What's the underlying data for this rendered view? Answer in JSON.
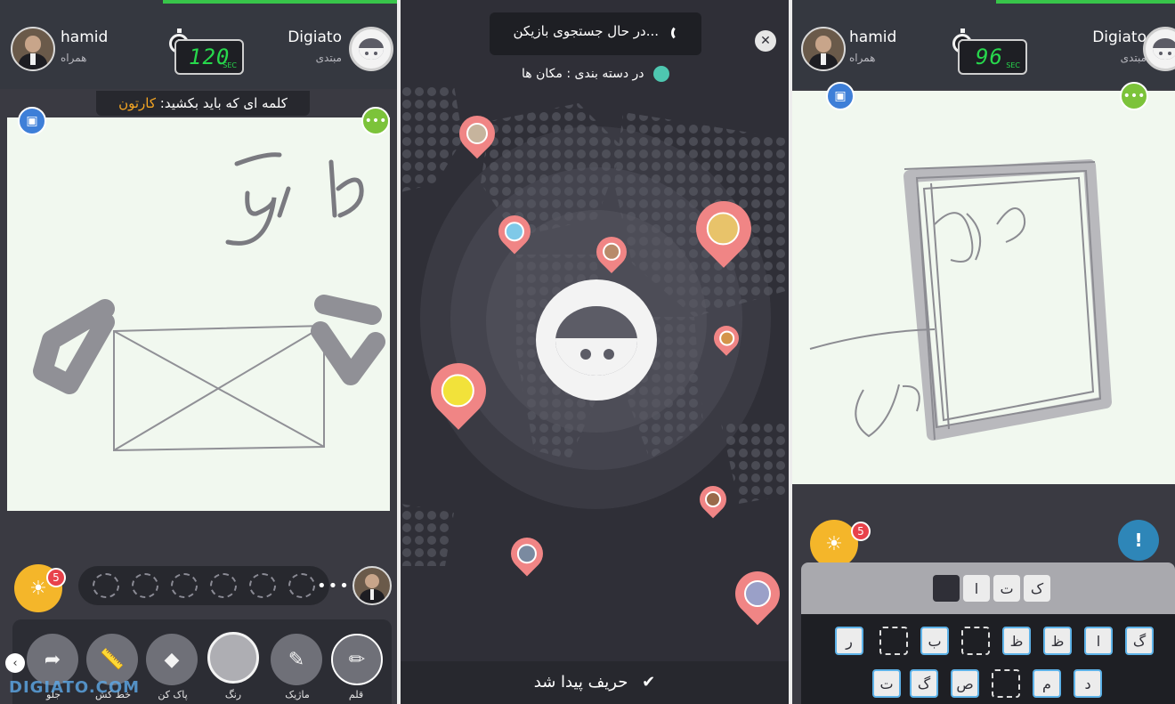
{
  "panel1": {
    "player_left": {
      "name": "hamid",
      "level": "همراه"
    },
    "player_right": {
      "name": "Digiato",
      "level": "مبتدی"
    },
    "timer": {
      "value": "120",
      "unit": "SEC"
    },
    "word_prompt": {
      "label": "کلمه ای که باید بکشید:",
      "word": "کارتون"
    },
    "hint_count": "5",
    "tools": [
      {
        "label": "جلو",
        "icon": "redo-arrow-icon"
      },
      {
        "label": "خط کش",
        "icon": "ruler-icon"
      },
      {
        "label": "پاک کن",
        "icon": "eraser-icon"
      },
      {
        "label": "رنگ",
        "icon": "color-swatch-icon"
      },
      {
        "label": "ماژیک",
        "icon": "marker-icon"
      },
      {
        "label": "قلم",
        "icon": "pen-icon"
      }
    ],
    "watermark": "DIGIATO.COM",
    "progress": 0.59
  },
  "panel2": {
    "searching": "در حال جستجوی بازیکن...",
    "category": "در دسته بندی : مکان ها",
    "found": "حریف پیدا شد"
  },
  "panel3": {
    "player_left": {
      "name": "hamid",
      "level": "همراه"
    },
    "player_right": {
      "name": "Digiato",
      "level": "مبتدی"
    },
    "timer": {
      "value": "96",
      "unit": "SEC"
    },
    "hint_count": "5",
    "answer_boxes": [
      "ک",
      "ت",
      "ا",
      ""
    ],
    "letter_row1": [
      "گ",
      "ا",
      "ظ",
      "ظ",
      "",
      "ب",
      "",
      "ر"
    ],
    "letter_row2": [
      "د",
      "م",
      "",
      "ص",
      "گ",
      "ت"
    ],
    "progress": 0.45
  },
  "colors": {
    "accent_green": "#38c54a",
    "timer_green": "#27d84c",
    "hint_yellow": "#f4b62a",
    "pin_red": "#f08585",
    "word_orange": "#f5a623"
  }
}
